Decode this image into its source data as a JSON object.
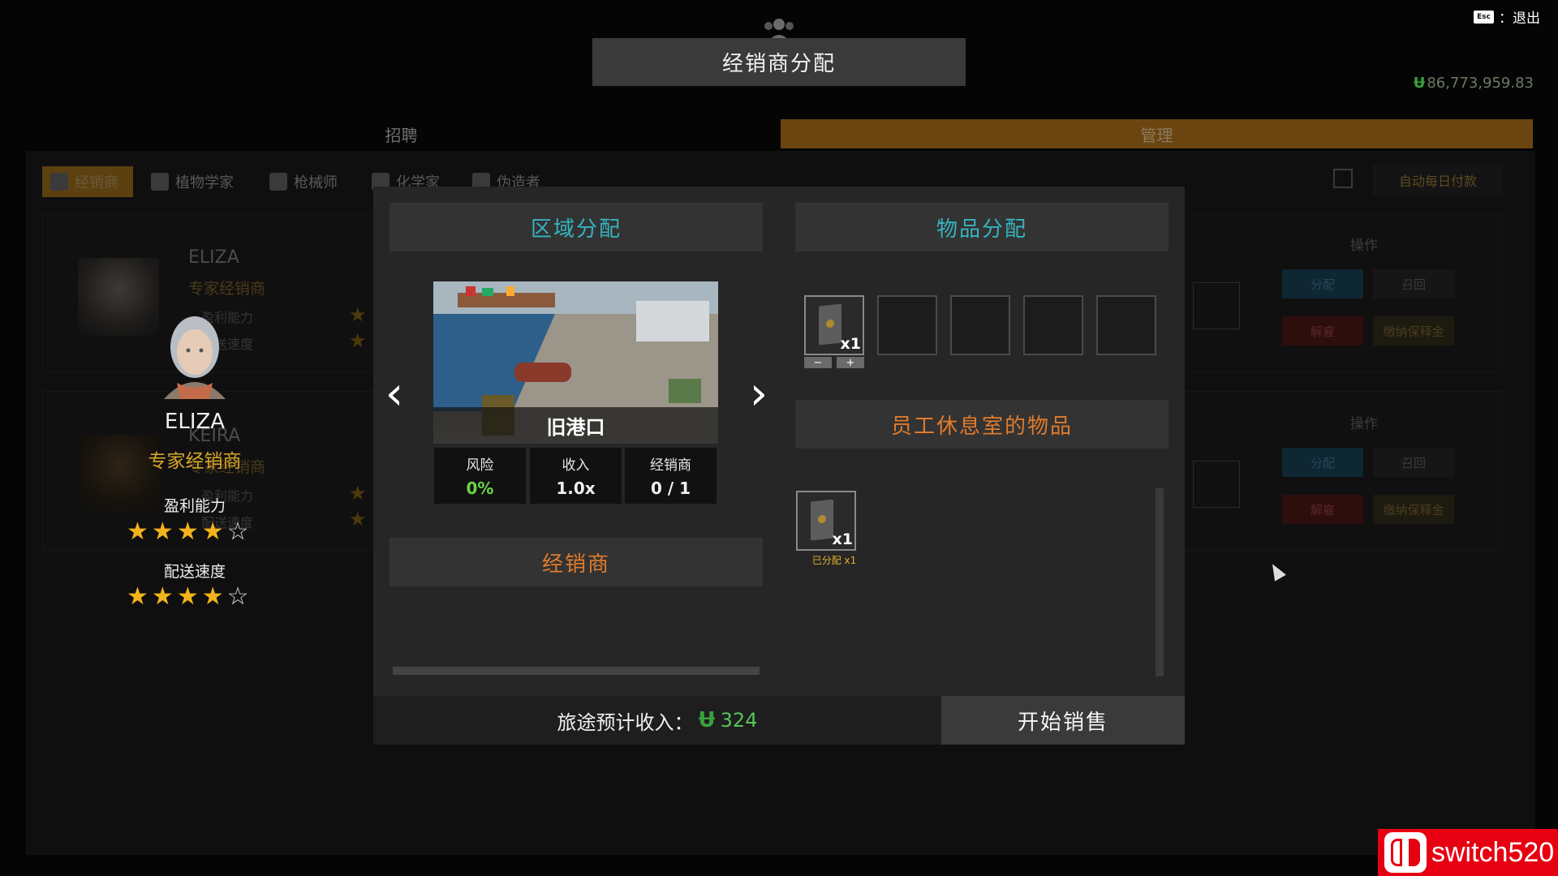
{
  "header": {
    "title": "经销商分配",
    "esc_key": "Esc",
    "esc_label": "：退出",
    "money": "86,773,959.83",
    "currency_symbol": "Ʉ"
  },
  "tabs": {
    "recruit": "招聘",
    "manage": "管理"
  },
  "categories": [
    {
      "label": "经销商",
      "active": true
    },
    {
      "label": "植物学家",
      "active": false
    },
    {
      "label": "枪械师",
      "active": false
    },
    {
      "label": "化学家",
      "active": false
    },
    {
      "label": "伪造者",
      "active": false
    }
  ],
  "auto_pay_label": "自动每日付款",
  "bg_cards": [
    {
      "name": "ELIZA",
      "role": "专家经销商",
      "stat1": "盈利能力",
      "stat2": "配送速度",
      "ops_label": "操作",
      "buttons": [
        "分配",
        "召回",
        "解雇",
        "缴纳保释金"
      ]
    },
    {
      "name": "KEIRA",
      "role": "专家经销商",
      "stat1": "盈利能力",
      "stat2": "配送速度",
      "ops_label": "操作",
      "buttons": [
        "分配",
        "召回",
        "解雇",
        "缴纳保释金"
      ]
    }
  ],
  "dealer": {
    "name": "ELIZA",
    "role": "专家经销商",
    "stat1_label": "盈利能力",
    "stat1_rating": 4,
    "stat2_label": "配送速度",
    "stat2_rating": 4,
    "max_rating": 5
  },
  "dialog": {
    "region_header": "区域分配",
    "items_header": "物品分配",
    "region_name": "旧港口",
    "stats": [
      {
        "label": "风险",
        "value": "0%"
      },
      {
        "label": "收入",
        "value": "1.0x"
      },
      {
        "label": "经销商",
        "value": "0 / 1"
      }
    ],
    "dealers_header": "经销商",
    "break_room_header": "员工休息室的物品",
    "slot_item_qty": "x1",
    "minus": "−",
    "plus": "+",
    "break_item_qty": "x1",
    "assigned_label": "已分配 x1",
    "income_label": "旅途预计收入：",
    "income_value": "324",
    "start_button": "开始销售"
  },
  "colors": {
    "accent_teal": "#35b4bf",
    "accent_orange": "#e27b2b",
    "gold": "#f2b31b",
    "money_green": "#57c35a"
  },
  "watermark": "switch520"
}
